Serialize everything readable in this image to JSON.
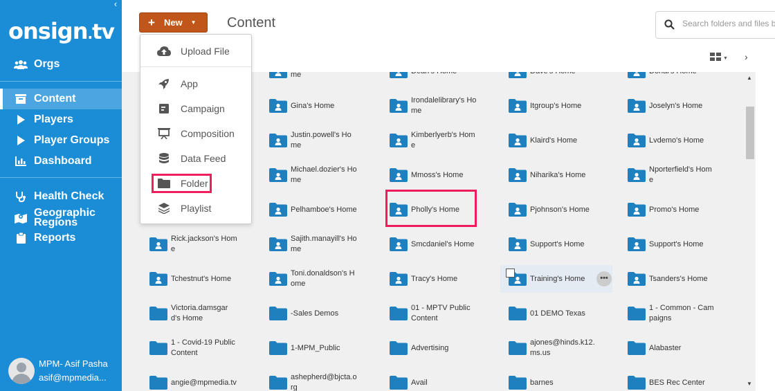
{
  "sidebar": {
    "logo": {
      "main": "onsign",
      "dot": ".",
      "tv": "tv"
    },
    "nav": [
      {
        "label": "Orgs",
        "icon": "users-icon"
      },
      {
        "label": "Content",
        "icon": "content-icon",
        "active": true
      },
      {
        "label": "Players",
        "icon": "play-icon"
      },
      {
        "label": "Player Groups",
        "icon": "play-icon"
      },
      {
        "label": "Dashboard",
        "icon": "bar-chart-icon"
      },
      {
        "label": "Health Check",
        "icon": "stethoscope-icon"
      },
      {
        "label": "Geographic Regions",
        "icon": "map-pin-icon"
      },
      {
        "label": "Reports",
        "icon": "clipboard-icon"
      }
    ],
    "user": {
      "name": "MPM- Asif Pasha",
      "email": "asif@mpmedia..."
    }
  },
  "toolbar": {
    "new_label": "New",
    "page_title": "Content",
    "search_placeholder": "Search folders and files b"
  },
  "new_menu": {
    "items": [
      "Upload File",
      "App",
      "Campaign",
      "Composition",
      "Data Feed",
      "Folder",
      "Playlist"
    ],
    "highlighted": "Folder"
  },
  "folders": {
    "partial_row": [
      "me",
      "Dean's Home",
      "Dave's Home",
      "Donal's Home"
    ],
    "rows": [
      [
        "",
        "Gina's Home",
        "Irondalelibrary's Home",
        "Itgroup's Home",
        "Joselyn's Home"
      ],
      [
        "",
        "Justin.powell's Home",
        "Kimberlyerb's Home",
        "Klaird's Home",
        "Lvdemo's Home"
      ],
      [
        "",
        "Michael.dozier's Home",
        "Mmoss's Home",
        "Niharika's Home",
        "Nporterfield's Home"
      ],
      [
        "",
        "Pelhamboe's Home",
        "Pholly's Home",
        "Pjohnson's Home",
        "Promo's Home"
      ],
      [
        "Rick.jackson's Home",
        "Sajith.manayill's Home",
        "Smcdaniel's Home",
        "Support's Home",
        "Support's Home"
      ],
      [
        "Tchestnut's Home",
        "Toni.donaldson's Home",
        "Tracy's Home",
        "Training's Home",
        "Tsanders's Home"
      ],
      [
        "Victoria.damsgard's Home",
        "-Sales Demos",
        "01 - MPTV Public Content",
        "01 DEMO Texas",
        "1 - Common - Campaigns"
      ],
      [
        "1 - Covid-19 Public Content",
        "1-MPM_Public",
        "Advertising",
        "ajones@hinds.k12.ms.us",
        "Alabaster"
      ],
      [
        "angie@mpmedia.tv",
        "ashepherd@bjcta.org",
        "Avail",
        "barnes",
        "BES Rec Center"
      ]
    ],
    "home_rows": [
      0,
      1,
      2,
      3,
      4,
      5
    ],
    "hovered": "Training's Home",
    "highlighted": "Pholly's Home"
  },
  "colors": {
    "sidebar": "#1b8cd6",
    "new_button": "#c0561a",
    "folder": "#1f80c0",
    "highlight": "#ee1d5c"
  }
}
